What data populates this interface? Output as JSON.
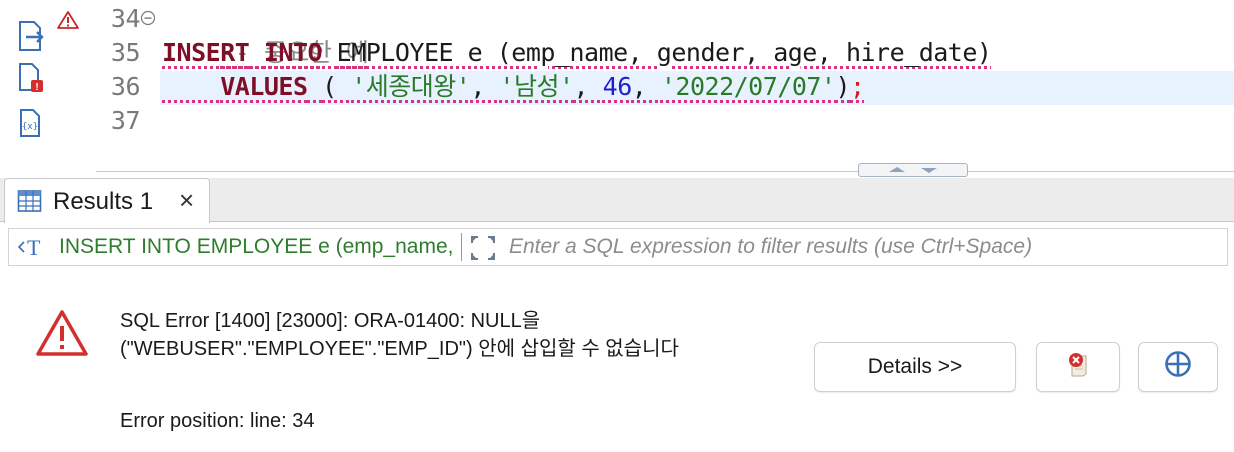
{
  "editor": {
    "line_numbers": [
      "34",
      "35",
      "36",
      "37"
    ],
    "line34": {
      "comment": "-- 중요한 예"
    },
    "line35": {
      "kw1": "INSERT",
      "kw2": "INTO",
      "rest": "EMPLOYEE e (emp_name, gender, age, hire_date)"
    },
    "line36": {
      "kw": "VALUES",
      "open": "( ",
      "s1": "'세종대왕'",
      "c1": ", ",
      "s2": "'남성'",
      "c2": ", ",
      "n1": "46",
      "c3": ", ",
      "s3": "'2022/07/07'",
      "close": ")",
      "semi": ";"
    }
  },
  "results": {
    "tab_label": "Results 1",
    "close_glyph": "×",
    "filter_sql": "INSERT INTO EMPLOYEE e (emp_name, gender, age, hire_date)",
    "filter_placeholder": "Enter a SQL expression to filter results (use Ctrl+Space)"
  },
  "error": {
    "line1": "SQL Error [1400] [23000]: ORA-01400: NULL을",
    "line2": "(\"WEBUSER\".\"EMPLOYEE\".\"EMP_ID\") 안에 삽입할 수 없습니다",
    "position": "Error position: line: 34",
    "details_button": "Details >>"
  },
  "colors": {
    "keyword": "#7f0f27",
    "string": "#2a7a2a",
    "number": "#1f1fd0",
    "error_red": "#d32f2f",
    "current_line": "#e8f2fe"
  },
  "icons": [
    "export-icon",
    "error-file-icon",
    "variables-icon",
    "warning-icon",
    "fold-icon",
    "table-icon",
    "close-icon",
    "sql-text-icon",
    "expand-icon",
    "error-icon",
    "clear-error-icon",
    "target-icon"
  ]
}
